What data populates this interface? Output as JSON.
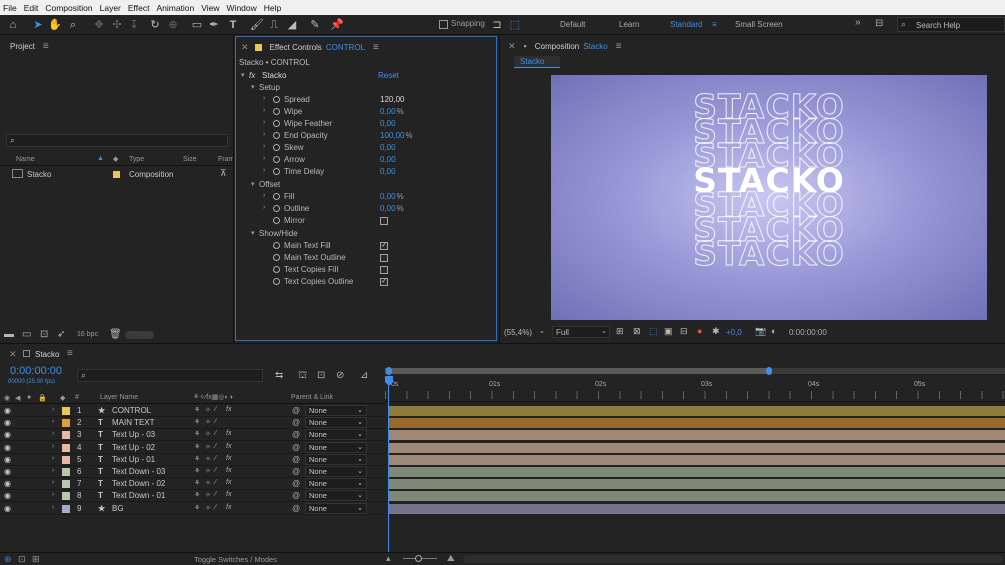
{
  "menu": [
    "File",
    "Edit",
    "Composition",
    "Layer",
    "Effect",
    "Animation",
    "View",
    "Window",
    "Help"
  ],
  "toolbar": {
    "snapping": "Snapping",
    "workspaces": [
      "Default",
      "Learn",
      "Standard",
      "Small Screen"
    ],
    "active_workspace": "Standard",
    "search_placeholder": "Search Help"
  },
  "project": {
    "title": "Project",
    "search_placeholder": "",
    "columns": [
      "Name",
      "Type",
      "Size",
      "Fram"
    ],
    "items": [
      {
        "name": "Stacko",
        "type": "Composition"
      }
    ],
    "bpc": "16 bpc"
  },
  "effect_controls": {
    "tab_label": "Effect Controls",
    "tab_layer": "CONTROL",
    "header": "Stacko • CONTROL",
    "effect_name": "Stacko",
    "reset": "Reset",
    "fx": "fx",
    "groups": {
      "setup": "Setup",
      "offset": "Offset",
      "showhide": "Show/Hide"
    },
    "props": {
      "spread": {
        "label": "Spread",
        "value": "120,00"
      },
      "wipe": {
        "label": "Wipe",
        "value": "0,00",
        "unit": "%"
      },
      "wipe_feather": {
        "label": "Wipe Feather",
        "value": "0,00"
      },
      "end_opacity": {
        "label": "End Opacity",
        "value": "100,00",
        "unit": "%"
      },
      "skew": {
        "label": "Skew",
        "value": "0,00"
      },
      "arrow": {
        "label": "Arrow",
        "value": "0,00"
      },
      "time_delay": {
        "label": "Time Delay",
        "value": "0,00"
      },
      "fill": {
        "label": "Fill",
        "value": "0,00",
        "unit": "%"
      },
      "outline": {
        "label": "Outline",
        "value": "0,00",
        "unit": "%"
      },
      "mirror": {
        "label": "Mirror",
        "checked": false
      },
      "main_text_fill": {
        "label": "Main Text Fill",
        "checked": true
      },
      "main_text_outline": {
        "label": "Main Text Outline",
        "checked": false
      },
      "text_copies_fill": {
        "label": "Text Copies Fill",
        "checked": false
      },
      "text_copies_outline": {
        "label": "Text Copies Outline",
        "checked": true
      }
    }
  },
  "composition": {
    "tab_label": "Composition",
    "tab_comp": "Stacko",
    "breadcrumb": "Stacko",
    "stack_text": "STACKO",
    "zoom": "(55,4%)",
    "resolution": "Full",
    "exposure": "+0,0",
    "timecode": "0:00:00:00"
  },
  "timeline": {
    "tab": "Stacko",
    "timecode": "0:00:00:00",
    "fps": "00000 (25.00 fps)",
    "search_placeholder": "",
    "col_num": "#",
    "col_layer_name": "Layer Name",
    "col_parent": "Parent & Link",
    "ruler": [
      "0s",
      "01s",
      "02s",
      "03s",
      "04s",
      "05s"
    ],
    "toggle": "Toggle Switches / Modes",
    "layers": [
      {
        "num": "1",
        "type": "★",
        "name": "CONTROL",
        "color": "#e6c95a",
        "parent": "None",
        "fx": true,
        "bar": "#8c7d3c"
      },
      {
        "num": "2",
        "type": "T",
        "name": "MAIN TEXT",
        "color": "#e0a040",
        "parent": "None",
        "fx": false,
        "bar": "#9a6a2c"
      },
      {
        "num": "3",
        "type": "T",
        "name": "Text Up - 03",
        "color": "#e8b8a0",
        "parent": "None",
        "fx": true,
        "bar": "#a08878"
      },
      {
        "num": "4",
        "type": "T",
        "name": "Text Up - 02",
        "color": "#e8b8a0",
        "parent": "None",
        "fx": true,
        "bar": "#a08878"
      },
      {
        "num": "5",
        "type": "T",
        "name": "Text Up - 01",
        "color": "#e8b8a0",
        "parent": "None",
        "fx": true,
        "bar": "#a08878"
      },
      {
        "num": "6",
        "type": "T",
        "name": "Text Down - 03",
        "color": "#b8c8b0",
        "parent": "None",
        "fx": true,
        "bar": "#7e8a78"
      },
      {
        "num": "7",
        "type": "T",
        "name": "Text Down - 02",
        "color": "#b8c8b0",
        "parent": "None",
        "fx": true,
        "bar": "#7e8a78"
      },
      {
        "num": "8",
        "type": "T",
        "name": "Text Down - 01",
        "color": "#b8c8b0",
        "parent": "None",
        "fx": true,
        "bar": "#7e8a78"
      },
      {
        "num": "9",
        "type": "★",
        "name": "BG",
        "color": "#a8a8d0",
        "parent": "None",
        "fx": true,
        "bar": "#74748c"
      }
    ]
  },
  "colors": {
    "accent": "#3c8fe8",
    "comp_bg": "#8a8ad0"
  }
}
